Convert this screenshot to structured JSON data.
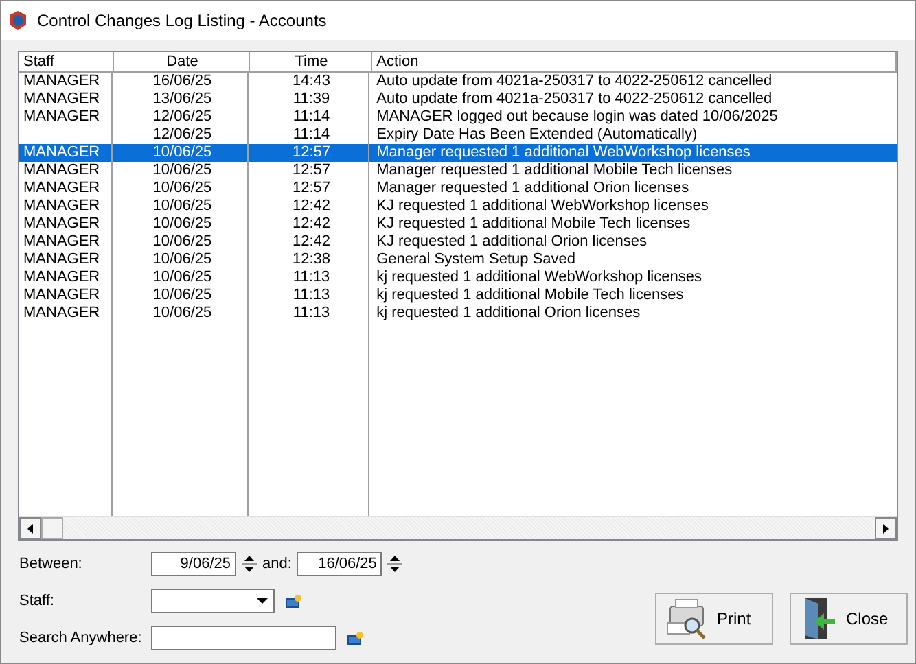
{
  "window": {
    "title": "Control Changes Log Listing - Accounts"
  },
  "table": {
    "columns": [
      "Staff",
      "Date",
      "Time",
      "Action"
    ],
    "rows": [
      {
        "cells": [
          "MANAGER",
          "16/06/25",
          "14:43",
          "Auto update from 4021a-250317 to 4022-250612 cancelled"
        ],
        "selected": false
      },
      {
        "cells": [
          "MANAGER",
          "13/06/25",
          "11:39",
          "Auto update from 4021a-250317 to 4022-250612 cancelled"
        ],
        "selected": false
      },
      {
        "cells": [
          "MANAGER",
          "12/06/25",
          "11:14",
          "MANAGER logged out because login was dated 10/06/2025"
        ],
        "selected": false
      },
      {
        "cells": [
          "",
          "12/06/25",
          "11:14",
          "Expiry Date Has Been Extended (Automatically)"
        ],
        "selected": false
      },
      {
        "cells": [
          "MANAGER",
          "10/06/25",
          "12:57",
          "Manager requested 1 additional WebWorkshop licenses"
        ],
        "selected": true
      },
      {
        "cells": [
          "MANAGER",
          "10/06/25",
          "12:57",
          "Manager requested 1 additional Mobile Tech licenses"
        ],
        "selected": false
      },
      {
        "cells": [
          "MANAGER",
          "10/06/25",
          "12:57",
          "Manager requested 1 additional Orion licenses"
        ],
        "selected": false
      },
      {
        "cells": [
          "MANAGER",
          "10/06/25",
          "12:42",
          "KJ requested 1 additional WebWorkshop licenses"
        ],
        "selected": false
      },
      {
        "cells": [
          "MANAGER",
          "10/06/25",
          "12:42",
          "KJ requested 1 additional Mobile Tech licenses"
        ],
        "selected": false
      },
      {
        "cells": [
          "MANAGER",
          "10/06/25",
          "12:42",
          "KJ requested 1 additional Orion licenses"
        ],
        "selected": false
      },
      {
        "cells": [
          "MANAGER",
          "10/06/25",
          "12:38",
          "General System Setup Saved"
        ],
        "selected": false
      },
      {
        "cells": [
          "MANAGER",
          "10/06/25",
          "11:13",
          "kj requested 1 additional WebWorkshop licenses"
        ],
        "selected": false
      },
      {
        "cells": [
          "MANAGER",
          "10/06/25",
          "11:13",
          "kj requested 1 additional Mobile Tech licenses"
        ],
        "selected": false
      },
      {
        "cells": [
          "MANAGER",
          "10/06/25",
          "11:13",
          "kj requested 1 additional Orion licenses"
        ],
        "selected": false
      }
    ]
  },
  "filters": {
    "between_label": "Between:",
    "from_date": "9/06/25",
    "and_label": "and:",
    "to_date": "16/06/25",
    "staff_label": "Staff:",
    "search_label": "Search Anywhere:"
  },
  "buttons": [
    "Print",
    "Close"
  ]
}
